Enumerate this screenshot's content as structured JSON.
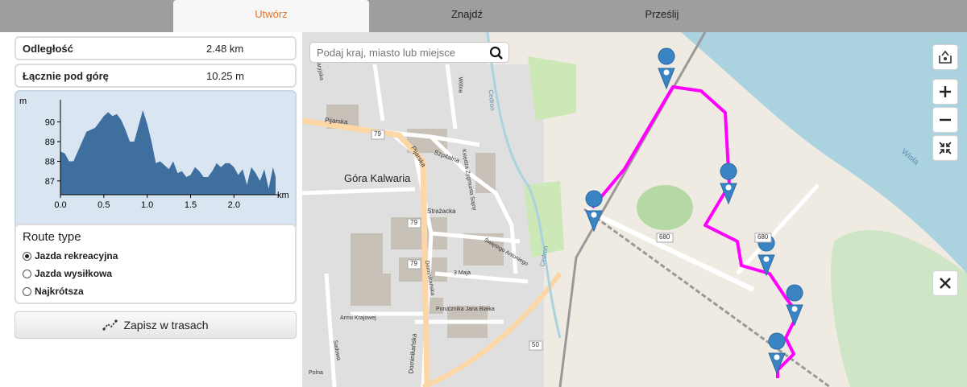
{
  "tabs": [
    {
      "label": "Utwórz",
      "active": true
    },
    {
      "label": "Znajdź",
      "active": false
    },
    {
      "label": "Prześlij",
      "active": false
    }
  ],
  "stats": {
    "distance_label": "Odległość",
    "distance_value": "2.48 km",
    "climb_label": "Łącznie pod górę",
    "climb_value": "10.25 m"
  },
  "chart_data": {
    "type": "area",
    "xlabel": "km",
    "ylabel": "m",
    "x_ticks": [
      "0.0",
      "0.5",
      "1.0",
      "1.5",
      "2.0"
    ],
    "y_ticks": [
      "87",
      "88",
      "89",
      "90"
    ],
    "xlim": [
      0,
      2.48
    ],
    "ylim": [
      86.3,
      90.8
    ],
    "x": [
      0,
      0.05,
      0.1,
      0.15,
      0.2,
      0.25,
      0.3,
      0.4,
      0.5,
      0.55,
      0.6,
      0.65,
      0.7,
      0.75,
      0.8,
      0.85,
      0.9,
      0.95,
      1.0,
      1.05,
      1.1,
      1.15,
      1.2,
      1.25,
      1.3,
      1.35,
      1.4,
      1.45,
      1.5,
      1.55,
      1.6,
      1.65,
      1.7,
      1.75,
      1.8,
      1.85,
      1.9,
      1.95,
      2.0,
      2.05,
      2.1,
      2.15,
      2.2,
      2.25,
      2.3,
      2.35,
      2.4,
      2.45,
      2.48
    ],
    "values": [
      88.5,
      88.4,
      88.0,
      88.0,
      88.5,
      89.0,
      89.5,
      89.7,
      90.3,
      90.5,
      90.3,
      90.4,
      90.1,
      89.6,
      89.0,
      89.0,
      89.8,
      90.6,
      89.9,
      89.0,
      87.9,
      88.0,
      87.8,
      87.6,
      88.0,
      87.4,
      87.5,
      87.2,
      87.3,
      87.7,
      87.5,
      87.2,
      87.2,
      87.5,
      87.9,
      87.7,
      87.9,
      87.9,
      87.7,
      87.3,
      87.6,
      86.8,
      87.7,
      87.4,
      87.0,
      87.6,
      86.6,
      87.7,
      87.2
    ],
    "color": "#3f6f9f",
    "background": "#d9e6f1",
    "grid": false
  },
  "route_type": {
    "title": "Route type",
    "options": [
      {
        "label": "Jazda rekreacyjna",
        "selected": true
      },
      {
        "label": "Jazda wysiłkowa",
        "selected": false
      },
      {
        "label": "Najkrótsza",
        "selected": false
      }
    ]
  },
  "save_label": "Zapisz w trasach",
  "search": {
    "placeholder": "Podaj kraj, miasto lub miejsce"
  },
  "map": {
    "town_label": "Góra Kalwaria",
    "streets": [
      "Pijarska",
      "Pijarska",
      "Szpitalna",
      "Księdza Zygmunta Sajny",
      "Strażacka",
      "Świętego Antoniego",
      "3 Maja",
      "Dominikańska",
      "Porucznika Jana Białka",
      "Armii Krajowej",
      "Dominikańska",
      "Wólna",
      "Sadowa",
      "Polna",
      "Kalwaryjska"
    ],
    "rivers": [
      "Cedron",
      "Cedron",
      "Wisła"
    ],
    "road_refs": [
      "79",
      "79",
      "79",
      "50",
      "680",
      "680"
    ],
    "route_color": "#ff00ff",
    "marker_color": "#3b84c4"
  }
}
